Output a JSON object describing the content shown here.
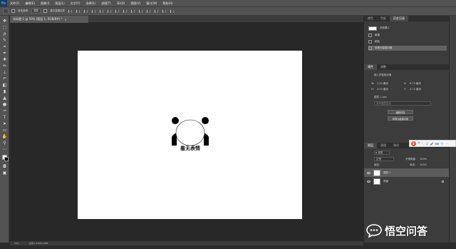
{
  "app": {
    "logo_text": "Ps"
  },
  "menu": [
    "文件(F)",
    "编辑(E)",
    "图像(I)",
    "图层(L)",
    "文字(Y)",
    "选择(S)",
    "滤镜(T)",
    "3D(D)",
    "视图(V)",
    "窗口(W)",
    "帮助(H)"
  ],
  "options_bar": {
    "auto_select_label": "自动选择:",
    "auto_select_value": "图层",
    "show_transform_label": "显示变换控件"
  },
  "document": {
    "tab_title": "未标题-1 @ 50% (图层 1, RGB/8#) *",
    "close_glyph": "×",
    "panda_caption": "羞无表情"
  },
  "statusbar": {
    "zoom": "50%",
    "doc_info": "文档:7.91M/3.28M"
  },
  "history_panel": {
    "tabs": [
      "颜色",
      "色板",
      "历史记录"
    ],
    "snapshot_label": "未标题-1",
    "steps": [
      "新建",
      "粘贴",
      "转换为智能对象"
    ],
    "selected_step_index": 2
  },
  "properties_panel": {
    "tabs": [
      "属性",
      "调整"
    ],
    "type_label": "嵌入的智能对象",
    "w_label": "W:",
    "w_value": "2.24 厘米",
    "h_label": "H:",
    "h_value": "2.24 厘米",
    "x_label": "X:",
    "x_value": "6.75 厘米",
    "y_label": "Y:",
    "y_value": "4.72 厘米",
    "layer_name_label": "图层 1.psb",
    "layer_comp_placeholder": "没有图层复合",
    "edit_contents_button": "编辑内容",
    "convert_to_linked_button": "转换为链接对象"
  },
  "ime_bar": {
    "logo": "S",
    "lang": "中",
    "items": [
      "°,",
      "☺",
      "🎤",
      "⌨",
      "👕",
      "⋯"
    ]
  },
  "layers_panel": {
    "tabs": [
      "图层",
      "通道",
      "路径"
    ],
    "filter_label": "ρ 类型",
    "blend_mode": "正常",
    "opacity_label": "不透明度:",
    "opacity_value": "100%",
    "lock_label": "锁定:",
    "fill_label": "填充:",
    "fill_value": "100%",
    "layers": [
      {
        "name": "图层 1",
        "selected": true,
        "locked": false
      },
      {
        "name": "背景",
        "selected": false,
        "locked": true
      }
    ]
  },
  "watermark": {
    "text": "悟空问答"
  },
  "colors": {
    "ui_bg": "#535353",
    "canvas_bg": "#282828",
    "artboard": "#ffffff",
    "accent": "#31a8ff"
  }
}
